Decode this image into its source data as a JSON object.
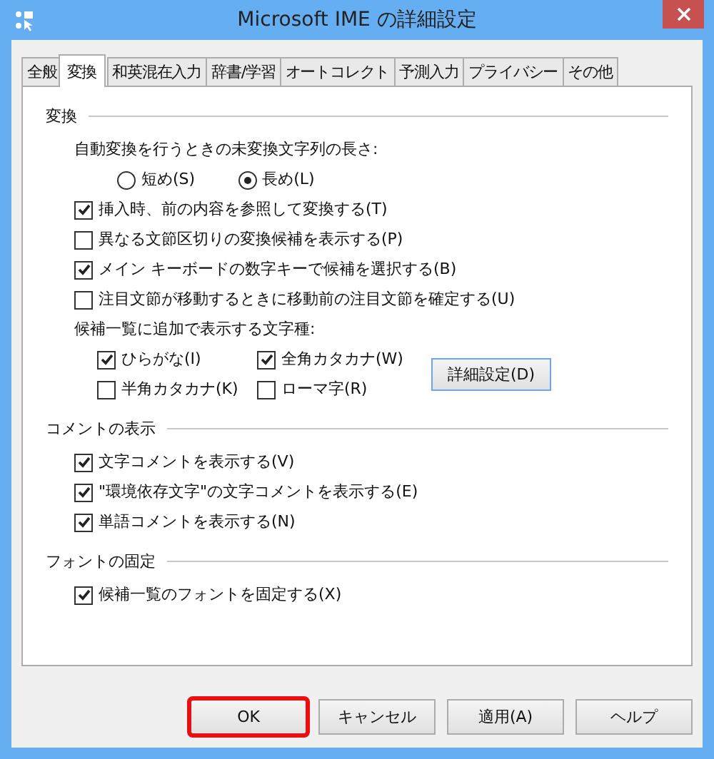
{
  "window": {
    "title": "Microsoft IME の詳細設定"
  },
  "tabs": [
    {
      "label": "全般",
      "selected": false
    },
    {
      "label": "変換",
      "selected": true
    },
    {
      "label": "和英混在入力",
      "selected": false
    },
    {
      "label": "辞書/学習",
      "selected": false
    },
    {
      "label": "オートコレクト",
      "selected": false
    },
    {
      "label": "予測入力",
      "selected": false
    },
    {
      "label": "プライバシー",
      "selected": false
    },
    {
      "label": "その他",
      "selected": false
    }
  ],
  "sections": [
    {
      "heading": "変換",
      "items": [
        {
          "kind": "label",
          "text": "自動変換を行うときの未変換文字列の長さ:"
        },
        {
          "kind": "radios",
          "options": [
            {
              "label": "短め(S)",
              "selected": false
            },
            {
              "label": "長め(L)",
              "selected": true
            }
          ]
        },
        {
          "kind": "checkbox",
          "label": "挿入時、前の内容を参照して変換する(T)",
          "checked": true
        },
        {
          "kind": "checkbox",
          "label": "異なる文節区切りの変換候補を表示する(P)",
          "checked": false
        },
        {
          "kind": "checkbox",
          "label": "メイン キーボードの数字キーで候補を選択する(B)",
          "checked": true
        },
        {
          "kind": "checkbox",
          "label": "注目文節が移動するときに移動前の注目文節を確定する(U)",
          "checked": false
        },
        {
          "kind": "label",
          "text": "候補一覧に追加で表示する文字種:"
        },
        {
          "kind": "checkgrid",
          "options": [
            {
              "label": "ひらがな(I)",
              "checked": true
            },
            {
              "label": "全角カタカナ(W)",
              "checked": true
            },
            {
              "label": "半角カタカナ(K)",
              "checked": false
            },
            {
              "label": "ローマ字(R)",
              "checked": false
            }
          ],
          "button": "詳細設定(D)"
        }
      ]
    },
    {
      "heading": "コメントの表示",
      "items": [
        {
          "kind": "checkbox",
          "label": "文字コメントを表示する(V)",
          "checked": true
        },
        {
          "kind": "checkbox",
          "label": "\"環境依存文字\"の文字コメントを表示する(E)",
          "checked": true
        },
        {
          "kind": "checkbox",
          "label": "単語コメントを表示する(N)",
          "checked": true
        }
      ]
    },
    {
      "heading": "フォントの固定",
      "items": [
        {
          "kind": "checkbox",
          "label": "候補一覧のフォントを固定する(X)",
          "checked": true
        }
      ]
    }
  ],
  "buttons": [
    {
      "label": "OK",
      "highlighted": true
    },
    {
      "label": "キャンセル",
      "highlighted": false
    },
    {
      "label": "適用(A)",
      "highlighted": false
    },
    {
      "label": "ヘルプ",
      "highlighted": false
    }
  ]
}
